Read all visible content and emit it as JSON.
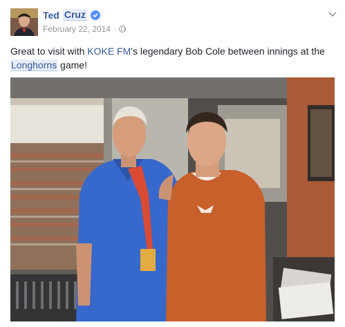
{
  "post": {
    "author_first": "Ted",
    "author_last": "Cruz",
    "date": "February 22, 2014",
    "date_separator": "·",
    "text_parts": {
      "p1": "Great to visit with ",
      "page_link": "KOKE FM",
      "p2": "'s legendary Bob Cole between innings at the ",
      "tag": "Longhorns",
      "p3": " game!"
    }
  },
  "icons": {
    "verified": "verified-badge-icon",
    "audience": "globe-icon",
    "menu": "chevron-down-icon"
  },
  "colors": {
    "link": "#365899",
    "meta": "#90949c",
    "verified": "#5890ff",
    "text": "#1d2129"
  }
}
